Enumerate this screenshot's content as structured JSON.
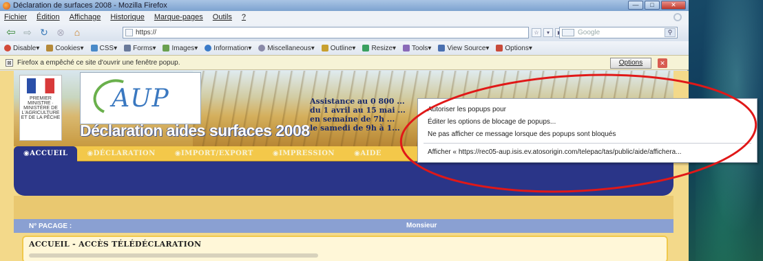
{
  "window": {
    "title": "Déclaration de surfaces 2008 - Mozilla Firefox",
    "controls": [
      "—",
      "□",
      "✕"
    ]
  },
  "menubar": {
    "items": [
      "Fichier",
      "Édition",
      "Affichage",
      "Historique",
      "Marque-pages",
      "Outils",
      "?"
    ]
  },
  "navbar": {
    "url": "https://",
    "search_placeholder": "Google"
  },
  "webdev_toolbar": {
    "items": [
      {
        "label": "Disable▾",
        "color": "#d24a3a"
      },
      {
        "label": "Cookies▾",
        "color": "#b58a3a"
      },
      {
        "label": "CSS▾",
        "color": "#4a8ac8"
      },
      {
        "label": "Forms▾",
        "color": "#6a7a9a"
      },
      {
        "label": "Images▾",
        "color": "#6aa050"
      },
      {
        "label": "Information▾",
        "color": "#3a7ac8"
      },
      {
        "label": "Miscellaneous▾",
        "color": "#8a8aa8"
      },
      {
        "label": "Outline▾",
        "color": "#c8a030"
      },
      {
        "label": "Resize▾",
        "color": "#3aa060"
      },
      {
        "label": "Tools▾",
        "color": "#8a6ab8"
      },
      {
        "label": "View Source▾",
        "color": "#4a70b0"
      },
      {
        "label": "Options▾",
        "color": "#c84a3a"
      }
    ]
  },
  "notification": {
    "message": "Firefox a empêché ce site d'ouvrir une fenêtre popup.",
    "options_label": "Options",
    "close_label": "✕"
  },
  "page": {
    "logo_rf_text": "PREMIER MINISTRE · MINISTÈRE DE L'AGRICULTURE ET DE LA PÊCHE",
    "logo_aup": "AUP",
    "banner_title": "Déclaration aides surfaces 2008",
    "assistance_lines": [
      "Assistance au 0 800 ...",
      "du 1 avril au 15 mai ...",
      "en semaine de 7h ...",
      "le samedi de 9h à 1..."
    ],
    "tabs": [
      "ACCUEIL",
      "DÉCLARATION",
      "IMPORT/EXPORT",
      "IMPRESSION",
      "AIDE"
    ],
    "pacage_label": "N° PACAGE :",
    "monsieur_label": "Monsieur",
    "accueil_title": "ACCUEIL - ACCÈS TÉLÉDÉCLARATION"
  },
  "popup_menu": {
    "items": [
      "Autoriser les popups pour",
      "Éditer les options de blocage de popups...",
      "Ne pas afficher ce message lorsque des popups sont bloqués"
    ],
    "show_item": "Afficher « https://rec05-aup.isis.ev.atosorigin.com/telepac/tas/public/aide/affichera..."
  },
  "colors": {
    "annotation": "#e01818",
    "nav_blue": "#2a3588",
    "tab_yellow": "#f3c84a"
  }
}
